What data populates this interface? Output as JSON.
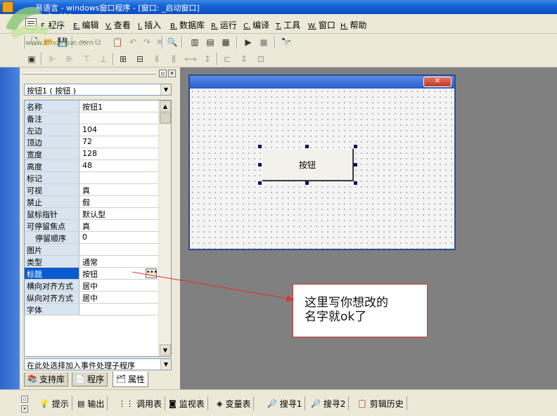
{
  "window": {
    "title": "易语言 - windows窗口程序 - [窗口: _启动窗口]"
  },
  "watermark": "www.smdaxue.com",
  "menu": [
    {
      "key": "F.",
      "label": "程序"
    },
    {
      "key": "E.",
      "label": "编辑"
    },
    {
      "key": "V.",
      "label": "查看"
    },
    {
      "key": "I.",
      "label": "插入"
    },
    {
      "key": "B.",
      "label": "数据库"
    },
    {
      "key": "R.",
      "label": "运行"
    },
    {
      "key": "C.",
      "label": "编译"
    },
    {
      "key": "T.",
      "label": "工具"
    },
    {
      "key": "W.",
      "label": "窗口"
    },
    {
      "key": "H.",
      "label": "帮助"
    }
  ],
  "panel": {
    "object_selector": "按钮1 ( 按钮 )",
    "event_selector": "在此处选择加入事件处理子程序",
    "properties": [
      {
        "name": "名称",
        "value": "按钮1"
      },
      {
        "name": "备注",
        "value": ""
      },
      {
        "name": "左边",
        "value": "104"
      },
      {
        "name": "顶边",
        "value": "72"
      },
      {
        "name": "宽度",
        "value": "128"
      },
      {
        "name": "高度",
        "value": "48"
      },
      {
        "name": "标记",
        "value": ""
      },
      {
        "name": "可视",
        "value": "真"
      },
      {
        "name": "禁止",
        "value": "假"
      },
      {
        "name": "鼠标指针",
        "value": "默认型"
      },
      {
        "name": "可停留焦点",
        "value": "真"
      },
      {
        "name": "停留顺序",
        "value": "0"
      },
      {
        "name": "图片",
        "value": ""
      },
      {
        "name": "类型",
        "value": "通常"
      },
      {
        "name": "标题",
        "value": "按钮"
      },
      {
        "name": "横向对齐方式",
        "value": "居中"
      },
      {
        "name": "纵向对齐方式",
        "value": "居中"
      },
      {
        "name": "字体",
        "value": ""
      }
    ],
    "selected_property": "标题",
    "tabs": [
      "支持库",
      "程序",
      "属性"
    ],
    "active_tab": "属性"
  },
  "form": {
    "close_glyph": "✕",
    "button_label": "按钮"
  },
  "annotation": {
    "line1": "这里写你想改的",
    "line2": "名字就ok了",
    "color": "#e03030"
  },
  "bottom_tabs": [
    {
      "icon": "hint-icon",
      "label": "提示"
    },
    {
      "icon": "output-icon",
      "label": "输出"
    },
    {
      "icon": "call-table-icon",
      "label": "调用表"
    },
    {
      "icon": "watch-icon",
      "label": "监视表"
    },
    {
      "icon": "variable-icon",
      "label": "变量表"
    },
    {
      "icon": "search1-icon",
      "label": "搜寻1"
    },
    {
      "icon": "search2-icon",
      "label": "搜寻2"
    },
    {
      "icon": "clipboard-icon",
      "label": "剪辑历史"
    }
  ],
  "colors": {
    "title_bar": "#0a4fc4",
    "selected_row": "#0a5bd0",
    "design_bg": "#808080"
  }
}
